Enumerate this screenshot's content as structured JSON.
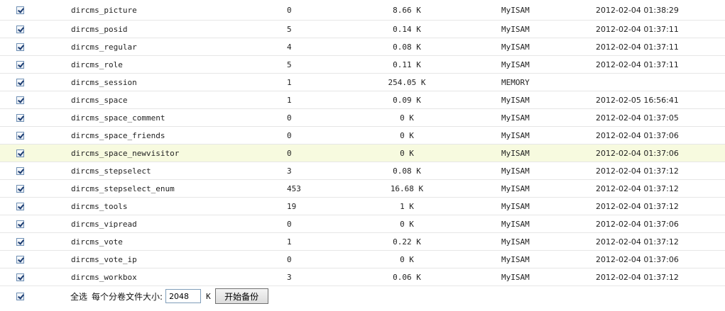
{
  "rows": [
    {
      "name": "dircms_picture",
      "rows": "0",
      "size": "8.66 K",
      "engine": "MyISAM",
      "updated": "2012-02-04 01:38:29"
    },
    {
      "name": "dircms_posid",
      "rows": "5",
      "size": "0.14 K",
      "engine": "MyISAM",
      "updated": "2012-02-04 01:37:11"
    },
    {
      "name": "dircms_regular",
      "rows": "4",
      "size": "0.08 K",
      "engine": "MyISAM",
      "updated": "2012-02-04 01:37:11"
    },
    {
      "name": "dircms_role",
      "rows": "5",
      "size": "0.11 K",
      "engine": "MyISAM",
      "updated": "2012-02-04 01:37:11"
    },
    {
      "name": "dircms_session",
      "rows": "1",
      "size": "254.05 K",
      "engine": "MEMORY",
      "updated": ""
    },
    {
      "name": "dircms_space",
      "rows": "1",
      "size": "0.09 K",
      "engine": "MyISAM",
      "updated": "2012-02-05 16:56:41"
    },
    {
      "name": "dircms_space_comment",
      "rows": "0",
      "size": "0 K",
      "engine": "MyISAM",
      "updated": "2012-02-04 01:37:05"
    },
    {
      "name": "dircms_space_friends",
      "rows": "0",
      "size": "0 K",
      "engine": "MyISAM",
      "updated": "2012-02-04 01:37:06"
    },
    {
      "name": "dircms_space_newvisitor",
      "rows": "0",
      "size": "0 K",
      "engine": "MyISAM",
      "updated": "2012-02-04 01:37:06"
    },
    {
      "name": "dircms_stepselect",
      "rows": "3",
      "size": "0.08 K",
      "engine": "MyISAM",
      "updated": "2012-02-04 01:37:12"
    },
    {
      "name": "dircms_stepselect_enum",
      "rows": "453",
      "size": "16.68 K",
      "engine": "MyISAM",
      "updated": "2012-02-04 01:37:12"
    },
    {
      "name": "dircms_tools",
      "rows": "19",
      "size": "1 K",
      "engine": "MyISAM",
      "updated": "2012-02-04 01:37:12"
    },
    {
      "name": "dircms_vipread",
      "rows": "0",
      "size": "0 K",
      "engine": "MyISAM",
      "updated": "2012-02-04 01:37:06"
    },
    {
      "name": "dircms_vote",
      "rows": "1",
      "size": "0.22 K",
      "engine": "MyISAM",
      "updated": "2012-02-04 01:37:12"
    },
    {
      "name": "dircms_vote_ip",
      "rows": "0",
      "size": "0 K",
      "engine": "MyISAM",
      "updated": "2012-02-04 01:37:06"
    },
    {
      "name": "dircms_workbox",
      "rows": "3",
      "size": "0.06 K",
      "engine": "MyISAM",
      "updated": "2012-02-04 01:37:12"
    }
  ],
  "highlight_index": 8,
  "footer": {
    "select_all_label": "全选",
    "volume_size_label": "每个分卷文件大小:",
    "volume_size_value": "2048",
    "unit": "K",
    "start_button_label": "开始备份"
  },
  "colors": {
    "highlight_row": "#f7fadf",
    "row_border": "#e6e6e6"
  }
}
